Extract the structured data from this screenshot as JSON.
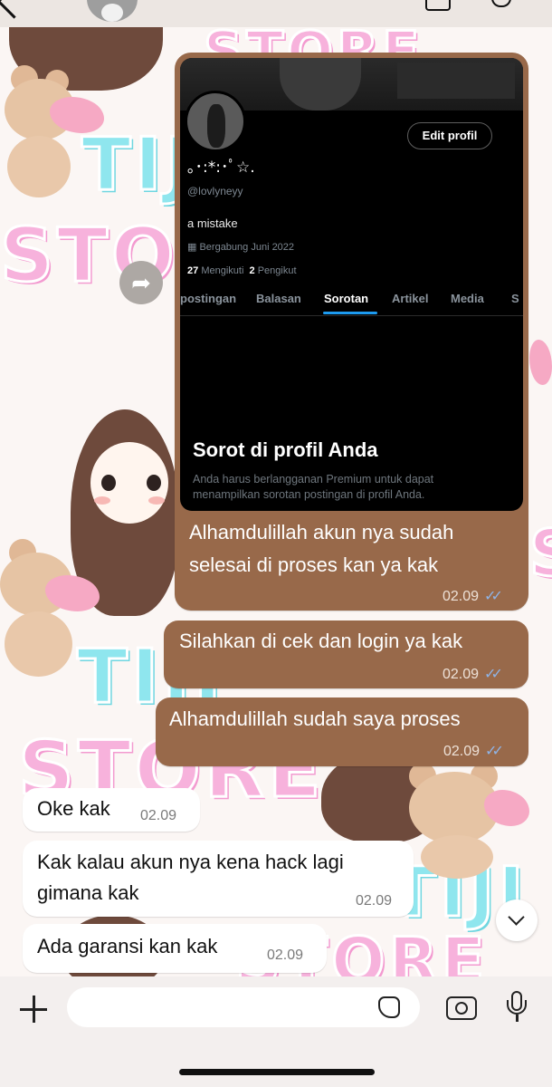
{
  "wallpaper": {
    "watermark_words": [
      "STORE",
      "TIJI",
      "STO",
      "TIJI",
      "STORE",
      "TIJI",
      "STORE"
    ],
    "colors": {
      "pink": "#f7b2dc",
      "cyan": "#8fe6ee",
      "bubble_out": "#98694a",
      "bubble_in": "#ffffff",
      "read_ticks": "#8fb4e6"
    }
  },
  "header": {
    "icons": [
      "back-icon",
      "contact-avatar",
      "video-call-icon",
      "voice-call-icon"
    ]
  },
  "screenshot_card": {
    "edit_button": "Edit profil",
    "display_name": "｡･:*:･ﾟ☆.",
    "handle": "@lovlyneyy",
    "bio": "a mistake",
    "joined": "Bergabung Juni 2022",
    "following_count": "27",
    "following_label": "Mengikuti",
    "followers_count": "2",
    "followers_label": "Pengikut",
    "tabs": [
      "postingan",
      "Balasan",
      "Sorotan",
      "Artikel",
      "Media",
      "S"
    ],
    "active_tab": "Sorotan",
    "highlight_title": "Sorot di profil Anda",
    "highlight_sub": "Anda harus berlangganan Premium untuk dapat menampilkan sorotan postingan di profil Anda.",
    "caption": "Alhamdulillah akun nya sudah selesai di proses kan ya kak",
    "time": "02.09",
    "ticks": "✓✓"
  },
  "messages": [
    {
      "direction": "out",
      "text": "Silahkan di cek dan login ya kak",
      "time": "02.09",
      "ticks": "✓✓"
    },
    {
      "direction": "out",
      "text": "Alhamdulillah sudah saya proses",
      "time": "02.09",
      "ticks": "✓✓"
    },
    {
      "direction": "in",
      "text": "Oke kak",
      "time": "02.09"
    },
    {
      "direction": "in",
      "text": "Kak kalau akun nya kena hack lagi gimana kak",
      "time": "02.09"
    },
    {
      "direction": "in",
      "text": "Ada garansi kan kak",
      "time": "02.09"
    }
  ],
  "composer": {
    "placeholder": "",
    "icons": [
      "plus-icon",
      "sticker-icon",
      "camera-icon",
      "microphone-icon"
    ]
  }
}
